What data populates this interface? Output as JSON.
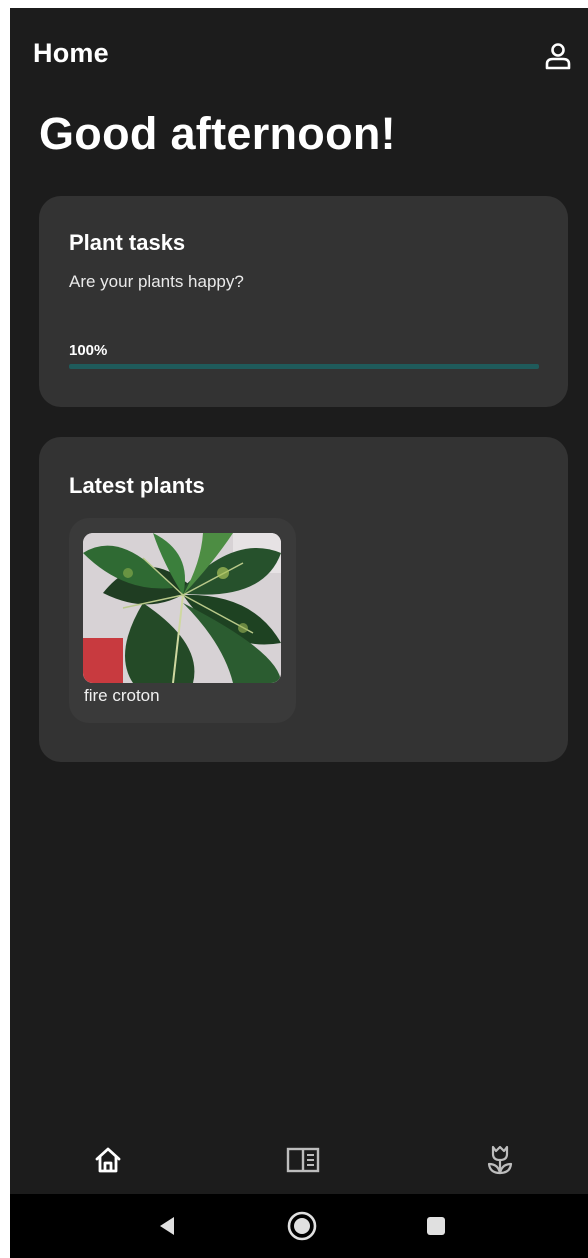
{
  "header": {
    "title": "Home",
    "profile_icon": "person-icon"
  },
  "greeting": "Good afternoon!",
  "tasks_card": {
    "title": "Plant tasks",
    "subtitle": "Are your plants happy?",
    "progress_label": "100%",
    "progress_value": 1.0,
    "progress_color": "#1f5b5b"
  },
  "latest_card": {
    "title": "Latest plants",
    "plants": [
      {
        "name": "fire croton",
        "photo_icon": "croton-leaves-photo"
      }
    ]
  },
  "bottom_nav": {
    "items": [
      {
        "icon": "home-icon",
        "active": true
      },
      {
        "icon": "guide-book-icon",
        "active": false
      },
      {
        "icon": "tulip-icon",
        "active": false
      }
    ]
  },
  "system_nav": {
    "items": [
      "back-icon",
      "home-circle-icon",
      "recents-square-icon"
    ]
  },
  "colors": {
    "background": "#1c1c1c",
    "card": "#333333",
    "tile": "#3a3a3a",
    "text": "#ffffff",
    "accent": "#1f5b5b"
  }
}
